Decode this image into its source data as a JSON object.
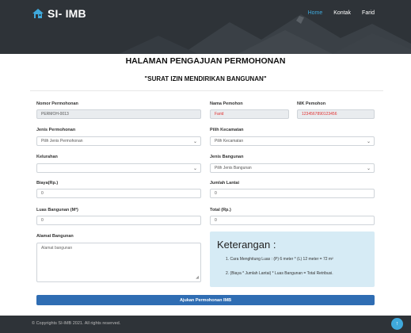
{
  "header": {
    "logo_text": "SI- IMB",
    "nav": [
      {
        "label": "Home",
        "active": true
      },
      {
        "label": "Kontak",
        "active": false
      },
      {
        "label": "Farid",
        "active": false
      }
    ],
    "colors": {
      "bg": "#2e3338",
      "accent": "#3fa9dc"
    }
  },
  "page": {
    "title": "HALAMAN PENGAJUAN PERMOHONAN",
    "subtitle": "\"SURAT IZIN MENDIRIKAN BANGUNAN\""
  },
  "form": {
    "nomor_permohonan": {
      "label": "Nomor Permohonan",
      "value": "PERMOH-0013"
    },
    "nama_pemohon": {
      "label": "Nama Pemohon",
      "value": "Farid"
    },
    "nik_pemohon": {
      "label": "NIK Pemohon",
      "value": "1234567890123456"
    },
    "jenis_permohonan": {
      "label": "Jenis Permohonan",
      "value": "Pilih Jenis Permohonan"
    },
    "kecamatan": {
      "label": "Pilih Kecamatan",
      "value": "Pilih Kecamatan"
    },
    "kelurahan": {
      "label": "Kelurahan",
      "value": ""
    },
    "jenis_bangunan": {
      "label": "Jenis Bangunan",
      "value": "Pilih Jenis Bangunan"
    },
    "biaya": {
      "label": "Biaya(Rp.)",
      "value": "0"
    },
    "jumlah_lantai": {
      "label": "Jumlah Lantai",
      "value": "0"
    },
    "luas_bangunan": {
      "label": "Luas Bangunan (M²)",
      "value": "0"
    },
    "total": {
      "label": "Total (Rp.)",
      "value": "0"
    },
    "alamat": {
      "label": "Alamat Bangunan",
      "placeholder": "Alamat bangunan"
    },
    "submit_label": "Ajukan Permohonan IMB"
  },
  "info": {
    "title": "Keterangan :",
    "items": [
      "1. Cara Menghitung Luas : (P) 6 meter * (L) 12 meter = 72 m²",
      "2. (Biaya * Jumlah Lantai) * Luas Bangunan = Total Retribusi."
    ]
  },
  "footer": {
    "text": "© Copyrights SI-IMB 2021. All rights reserved."
  }
}
